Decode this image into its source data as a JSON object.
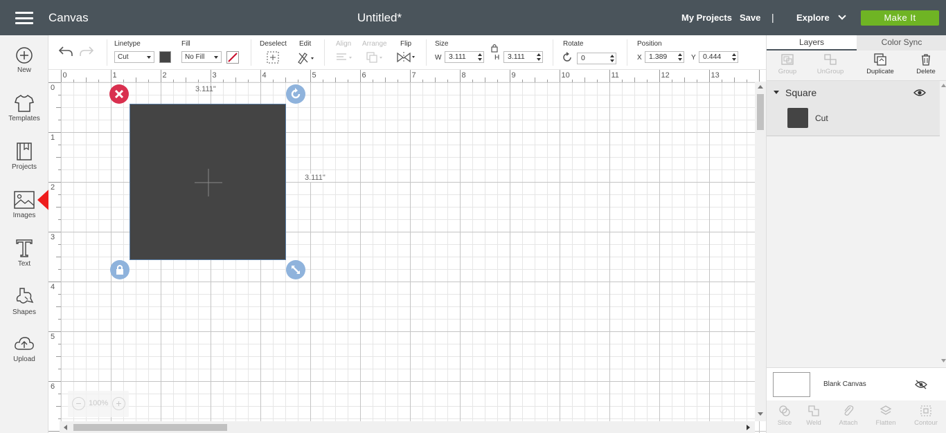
{
  "header": {
    "app_title": "Canvas",
    "doc_title": "Untitled*",
    "my_projects": "My Projects",
    "save": "Save",
    "separator": "|",
    "explore": "Explore",
    "make_it": "Make It"
  },
  "nav": {
    "items": [
      {
        "label": "New",
        "icon": "plus-circle-icon"
      },
      {
        "label": "Templates",
        "icon": "tshirt-icon"
      },
      {
        "label": "Projects",
        "icon": "notebook-icon"
      },
      {
        "label": "Images",
        "icon": "image-icon"
      },
      {
        "label": "Text",
        "icon": "text-t-icon"
      },
      {
        "label": "Shapes",
        "icon": "shapes-icon"
      },
      {
        "label": "Upload",
        "icon": "cloud-upload-icon"
      }
    ]
  },
  "toolbar": {
    "linetype_label": "Linetype",
    "linetype_value": "Cut",
    "fill_label": "Fill",
    "fill_value": "No Fill",
    "deselect_label": "Deselect",
    "edit_label": "Edit",
    "align_label": "Align",
    "arrange_label": "Arrange",
    "flip_label": "Flip",
    "size_label": "Size",
    "w_label": "W",
    "w_value": "3.111",
    "h_label": "H",
    "h_value": "3.111",
    "rotate_label": "Rotate",
    "rotate_value": "0",
    "position_label": "Position",
    "x_label": "X",
    "x_value": "1.389",
    "y_label": "Y",
    "y_value": "0.444"
  },
  "ruler": {
    "h_ticks": [
      "0",
      "1",
      "2",
      "3",
      "4",
      "5",
      "6",
      "7",
      "8",
      "9",
      "10",
      "11",
      "12",
      "13"
    ],
    "v_ticks": [
      "0",
      "1",
      "2",
      "3",
      "4",
      "5",
      "6"
    ]
  },
  "canvas": {
    "width_dim": "3.111\"",
    "height_dim": "3.111\"",
    "shape_color": "#444444",
    "zoom_value": "100%",
    "zoom_minus": "−",
    "zoom_plus": "+"
  },
  "right_panel": {
    "tab_layers": "Layers",
    "tab_color_sync": "Color Sync",
    "group": "Group",
    "ungroup": "UnGroup",
    "duplicate": "Duplicate",
    "delete": "Delete",
    "layer_name": "Square",
    "layer_operation": "Cut",
    "blank_canvas": "Blank Canvas",
    "slice": "Slice",
    "weld": "Weld",
    "attach": "Attach",
    "flatten": "Flatten",
    "contour": "Contour"
  },
  "colors": {
    "header_bg": "#4a545b",
    "make_it_green": "#6fb424",
    "delete_red": "#d9304f",
    "handle_blue": "#8fb3dc",
    "arrow_red": "#ee1c1c"
  }
}
